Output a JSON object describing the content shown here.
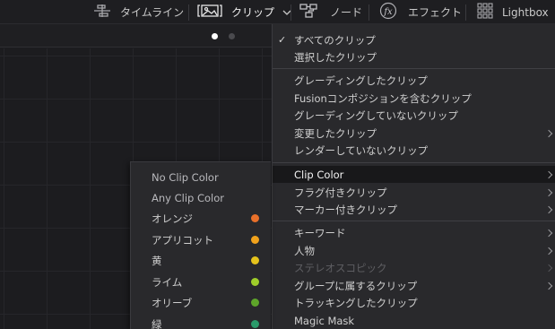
{
  "toolbar": {
    "timeline_label": "タイムライン",
    "clips_label": "クリップ",
    "nodes_label": "ノード",
    "effects_label": "エフェクト",
    "lightbox_label": "Lightbox",
    "icons": [
      "timeline-icon",
      "clips-icon",
      "chevron-down-icon",
      "nodes-icon",
      "fx-icon",
      "lightbox-grid-icon"
    ]
  },
  "page_dots": {
    "active_color": "#ffffff",
    "inactive_color": "#4a4a4e"
  },
  "menu": {
    "items": [
      {
        "label": "すべてのクリップ",
        "checked": true,
        "submenu": false
      },
      {
        "label": "選択したクリップ",
        "checked": false,
        "submenu": false
      },
      {
        "label": "グレーディングしたクリップ",
        "checked": false,
        "submenu": false
      },
      {
        "label": "Fusionコンポジションを含むクリップ",
        "checked": false,
        "submenu": false
      },
      {
        "label": "グレーディングしていないクリップ",
        "checked": false,
        "submenu": false
      },
      {
        "label": "変更したクリップ",
        "checked": false,
        "submenu": true
      },
      {
        "label": "レンダーしていないクリップ",
        "checked": false,
        "submenu": false
      },
      {
        "label": "Clip Color",
        "checked": false,
        "submenu": true,
        "highlighted": true
      },
      {
        "label": "フラグ付きクリップ",
        "checked": false,
        "submenu": true
      },
      {
        "label": "マーカー付きクリップ",
        "checked": false,
        "submenu": true
      },
      {
        "label": "キーワード",
        "checked": false,
        "submenu": true
      },
      {
        "label": "人物",
        "checked": false,
        "submenu": true
      },
      {
        "label": "ステレオスコピック",
        "checked": false,
        "submenu": true,
        "disabled": true
      },
      {
        "label": "グループに属するクリップ",
        "checked": false,
        "submenu": true
      },
      {
        "label": "トラッキングしたクリップ",
        "checked": false,
        "submenu": false
      },
      {
        "label": "Magic Mask",
        "checked": false,
        "submenu": false
      }
    ],
    "checkmark": "✓"
  },
  "clip_color_submenu": {
    "items": [
      {
        "label": "No Clip Color",
        "color": null
      },
      {
        "label": "Any Clip Color",
        "color": null
      },
      {
        "label": "オレンジ",
        "color": "#e8702a"
      },
      {
        "label": "アプリコット",
        "color": "#f0a21c"
      },
      {
        "label": "黄",
        "color": "#e4c21c"
      },
      {
        "label": "ライム",
        "color": "#9fcd2a"
      },
      {
        "label": "オリーブ",
        "color": "#5ea52a"
      },
      {
        "label": "緑",
        "color": "#2a9a6a"
      }
    ]
  }
}
